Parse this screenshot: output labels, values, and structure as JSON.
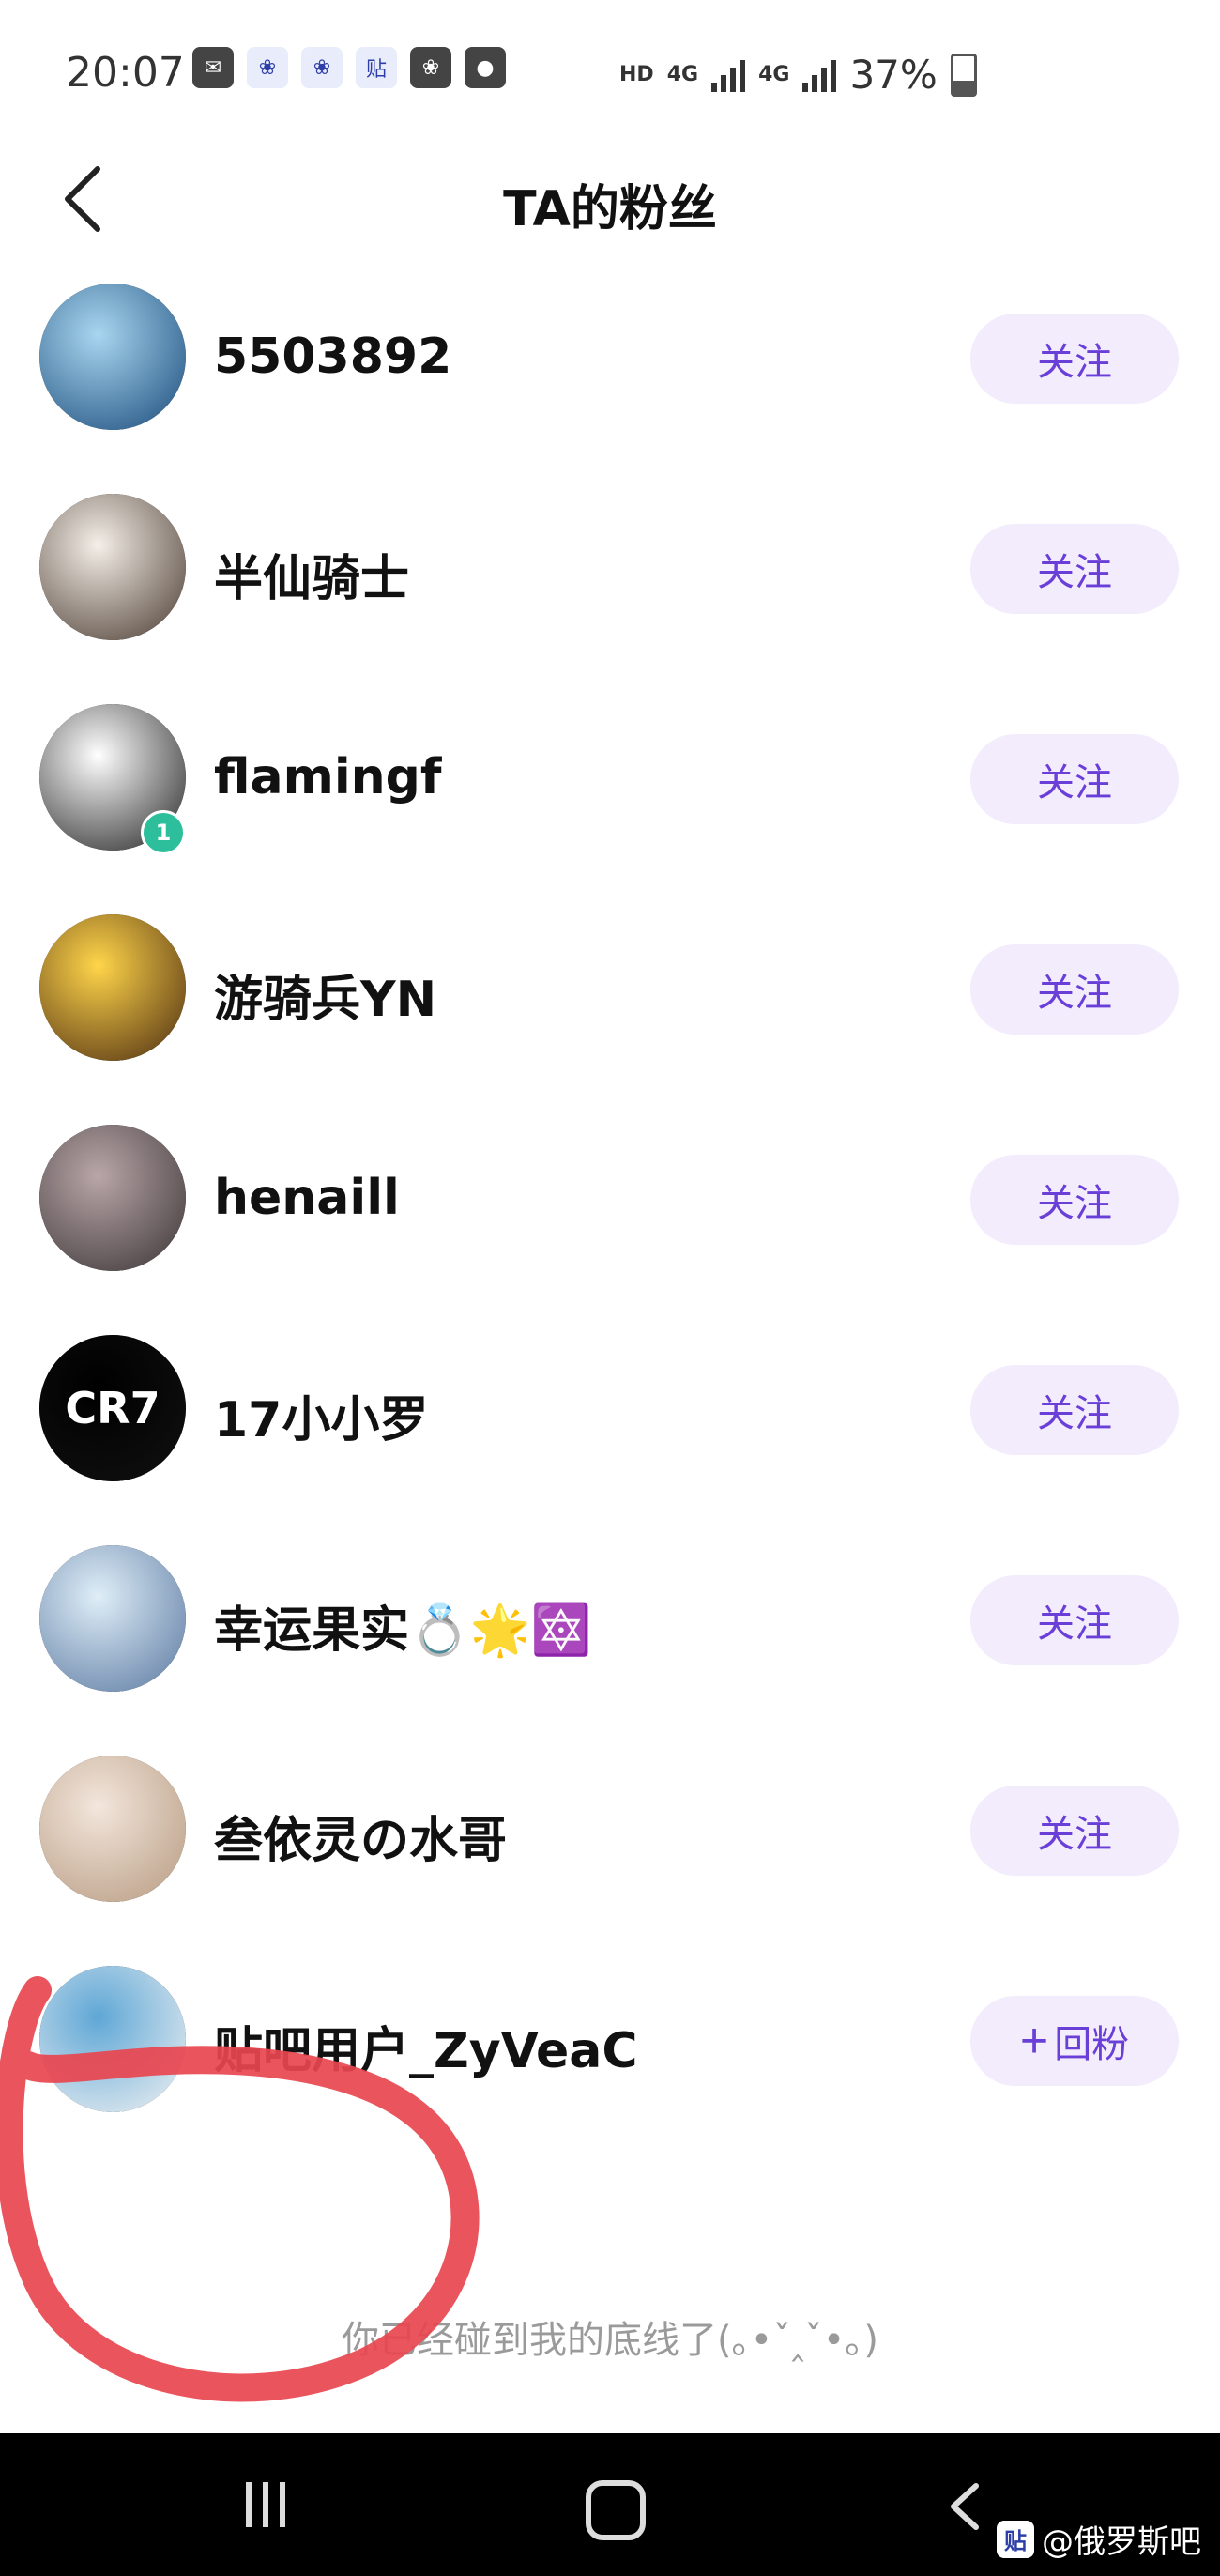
{
  "status_bar": {
    "time": "20:07",
    "network_hd": "HD",
    "network_1": "4G",
    "network_2": "4G",
    "battery": "37%",
    "notification_icons": [
      "wechat-icon",
      "baidu-icon",
      "baidu-icon",
      "tieba-icon",
      "paw-icon",
      "planet-icon"
    ]
  },
  "header": {
    "title": "TA的粉丝"
  },
  "followers": [
    {
      "name": "5503892",
      "action": "关注",
      "avatar_colors": [
        "#a8d6f0",
        "#1a4b7a"
      ]
    },
    {
      "name": "半仙骑士",
      "action": "关注",
      "avatar_colors": [
        "#f4efe8",
        "#4a3a30"
      ]
    },
    {
      "name": "flamingf",
      "action": "关注",
      "avatar_colors": [
        "#ffffff",
        "#222222"
      ],
      "badge": "1"
    },
    {
      "name": "游骑兵YN",
      "action": "关注",
      "avatar_colors": [
        "#ffd54a",
        "#4a2a10"
      ]
    },
    {
      "name": "henaill",
      "action": "关注",
      "avatar_colors": [
        "#b9a6a8",
        "#3a3436"
      ]
    },
    {
      "name": "17小小罗",
      "action": "关注",
      "avatar_colors": [
        "#000000",
        "#111111"
      ],
      "avatar_text": "CR7"
    },
    {
      "name": "幸运果实💍🌟🔯",
      "action": "关注",
      "avatar_colors": [
        "#dfeef8",
        "#5a78a0"
      ]
    },
    {
      "name": "叁依灵の水哥",
      "action": "关注",
      "avatar_colors": [
        "#f3e6dc",
        "#b69a80"
      ]
    },
    {
      "name": "贴吧用户_ZyVeaC",
      "action": "回粉",
      "action_plus": "+",
      "avatar_colors": [
        "#5fa7d6",
        "#f2f2f2"
      ]
    }
  ],
  "end_text": "你已经碰到我的底线了(｡•ˇ‸ˇ•｡)",
  "watermark": {
    "logo": "贴",
    "text": "@俄罗斯吧"
  },
  "colors": {
    "accent": "#6a3fd8",
    "button_bg": "#f3ecfc",
    "annotation": "#e8454f"
  }
}
